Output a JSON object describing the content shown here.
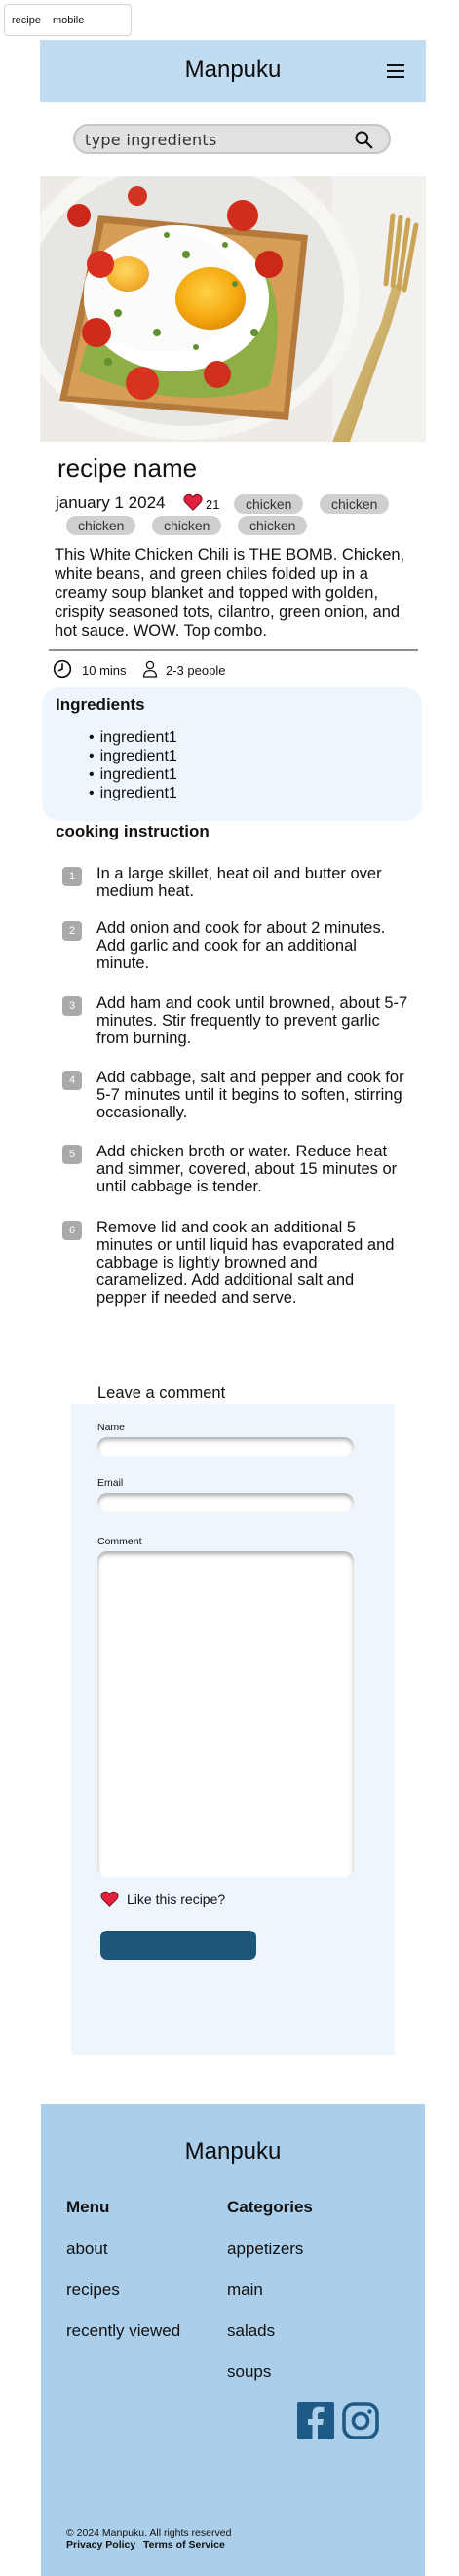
{
  "browser_tab": {
    "labels": [
      "recipe",
      "mobile"
    ]
  },
  "header": {
    "brand": "Manpuku",
    "menu_icon": "hamburger-menu-icon"
  },
  "search": {
    "placeholder": "type ingredients",
    "icon": "search-icon"
  },
  "recipe": {
    "title": "recipe name",
    "date": "january 1 2024",
    "like_count": "21",
    "tags": [
      "chicken",
      "chicken",
      "chicken",
      "chicken",
      "chicken"
    ],
    "description": "This White Chicken Chili is THE BOMB. Chicken, white beans, and green chiles folded up in a creamy soup blanket and topped with golden, crispity seasoned tots, cilantro, green onion, and hot sauce. WOW. Top combo.",
    "time": "10 mins",
    "serves": "2-3 people"
  },
  "ingredients": {
    "title": "Ingredients",
    "items": [
      "ingredient1",
      "ingredient1",
      "ingredient1",
      "ingredient1"
    ]
  },
  "instructions": {
    "title": "cooking instruction",
    "steps": [
      {
        "num": "1",
        "text": "In a large skillet, heat oil and butter over medium heat."
      },
      {
        "num": "2",
        "text": "Add onion and cook for about 2 minutes. Add garlic and cook for an additional minute."
      },
      {
        "num": "3",
        "text": "Add ham and cook until browned, about 5-7 minutes. Stir frequently to prevent garlic from burning."
      },
      {
        "num": "4",
        "text": "Add cabbage, salt and pepper and cook for 5-7 minutes until it begins to soften, stirring occasionally."
      },
      {
        "num": "5",
        "text": "Add chicken broth or water. Reduce heat and simmer, covered, about 15 minutes or until cabbage is tender."
      },
      {
        "num": "6",
        "text": "Remove lid and cook an additional 5 minutes or until liquid has evaporated and cabbage is lightly browned and caramelized. Add additional salt and pepper if needed and serve."
      }
    ]
  },
  "comment": {
    "title": "Leave a comment",
    "name_label": "Name",
    "email_label": "Email",
    "comment_label": "Comment",
    "like_label": "Like this recipe?",
    "submit_label": ""
  },
  "footer": {
    "brand": "Manpuku",
    "menu_title": "Menu",
    "menu_items": [
      "about",
      "recipes",
      "recently viewed"
    ],
    "categories_title": "Categories",
    "categories": [
      "appetizers",
      "main",
      "salads",
      "soups"
    ],
    "social": [
      "facebook-icon",
      "instagram-icon"
    ],
    "copyright": "© 2024 Manpuku. All rights reserved",
    "privacy": "Privacy Policy",
    "terms": "Terms of Service"
  },
  "colors": {
    "header_bg": "#c1dcf0",
    "footer_bg": "#abcfeb",
    "panel_bg": "#eef6fd",
    "tag_bg": "#cfcfcf",
    "heart": "#e0213c",
    "submit_button": "#1b5679",
    "social_icons": "#1f5a86"
  }
}
